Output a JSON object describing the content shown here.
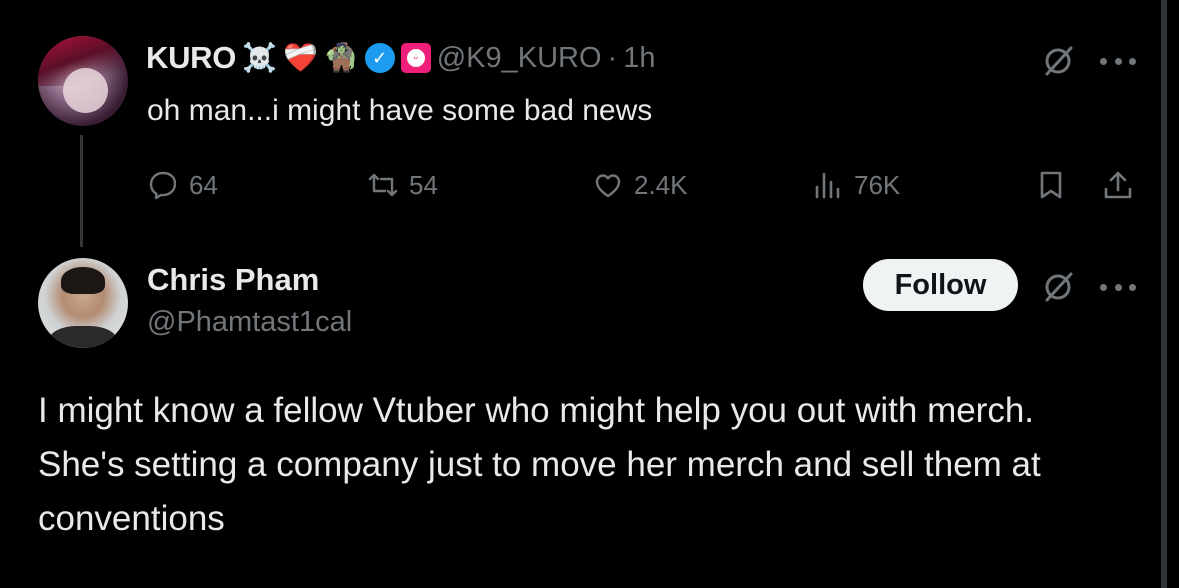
{
  "parent_tweet": {
    "display_name": "KURO",
    "emojis": [
      "☠️",
      "❤️‍🩹",
      "🧌"
    ],
    "handle": "@K9_KURO",
    "separator": "·",
    "time": "1h",
    "text": "oh man...i might have some bad news",
    "stats": {
      "replies": "64",
      "reposts": "54",
      "likes": "2.4K",
      "views": "76K"
    }
  },
  "reply": {
    "display_name": "Chris Pham",
    "handle": "@Phamtast1cal",
    "follow_label": "Follow",
    "text": "I might know a fellow Vtuber who might help you out with merch. She's setting a company just to move her merch and sell them at conventions"
  },
  "icons": {
    "verified": "verified-badge-icon",
    "affiliate": "affiliate-badge-icon",
    "grok": "grok-icon",
    "more": "more-icon",
    "reply": "reply-icon",
    "repost": "repost-icon",
    "like": "like-icon",
    "views": "views-icon",
    "bookmark": "bookmark-icon",
    "share": "share-icon"
  },
  "colors": {
    "background": "#000000",
    "text_primary": "#e7e9ea",
    "text_secondary": "#71767b",
    "verified_blue": "#1d9bf0",
    "affiliate_pink": "#f0207a",
    "follow_button_bg": "#eff3f4"
  }
}
